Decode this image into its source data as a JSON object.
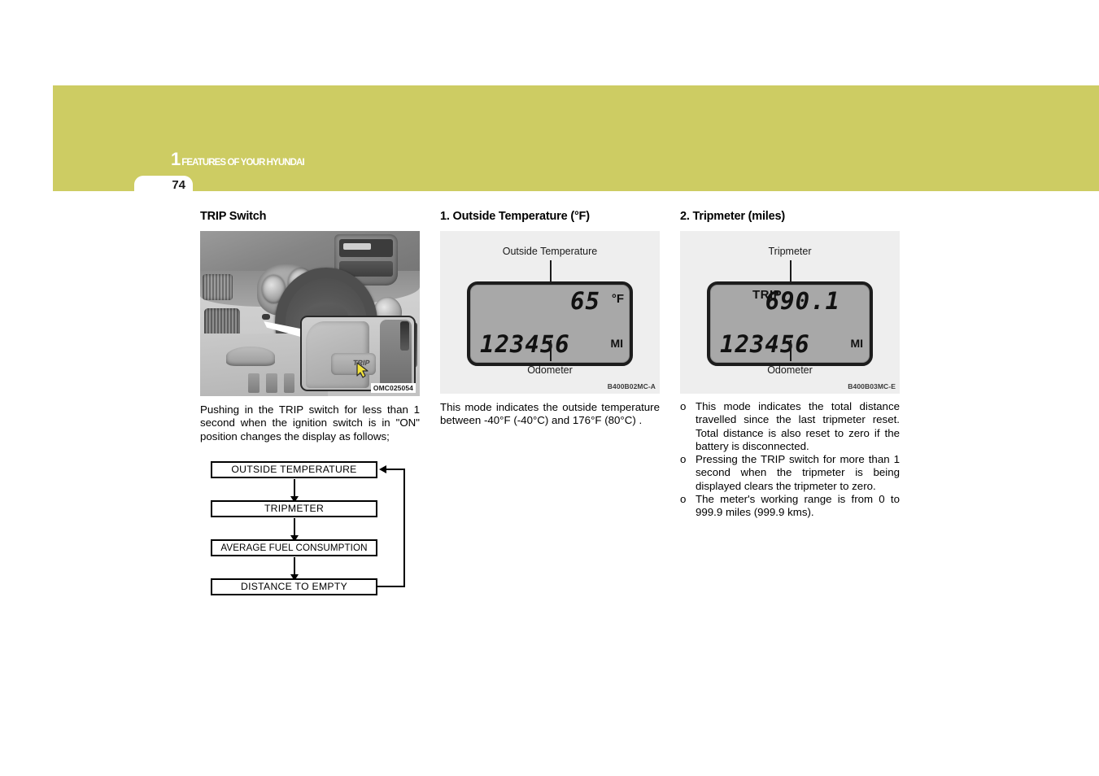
{
  "header": {
    "chapter_number": "1",
    "chapter_title": "FEATURES OF YOUR HYUNDAI",
    "page_number": "74",
    "banner_color": "#cdcc63"
  },
  "columns": {
    "left": {
      "heading": "TRIP Switch",
      "figure_code": "OMC025054",
      "paragraph": "Pushing in the TRIP switch for less than 1 second when the ignition switch is in \"ON\" position changes the display as follows;",
      "flowchart": {
        "steps": [
          "OUTSIDE TEMPERATURE",
          "TRIPMETER",
          "AVERAGE FUEL CONSUMPTION",
          "DISTANCE TO EMPTY"
        ]
      },
      "inset_button_label": "TRIP"
    },
    "middle": {
      "heading": "1. Outside Temperature (°F)",
      "figure_code": "B400B02MC-A",
      "caption_top": "Outside  Temperature",
      "caption_bottom": "Odometer",
      "lcd": {
        "temperature": "65",
        "temperature_unit": "°F",
        "odometer": "123456",
        "odometer_unit": "MI"
      },
      "paragraph": "This mode indicates the outside temperature between -40°F (-40°C) and 176°F (80°C) ."
    },
    "right": {
      "heading": "2. Tripmeter (miles)",
      "figure_code": "B400B03MC-E",
      "caption_top": "Tripmeter",
      "caption_bottom": "Odometer",
      "lcd": {
        "trip_label": "TRIP",
        "trip_value": "690.1",
        "odometer": "123456",
        "odometer_unit": "MI"
      },
      "bullets": [
        {
          "mark": "o",
          "text": "This mode indicates the total distance travelled since the last tripmeter reset. Total distance is also reset to zero if the battery is disconnected."
        },
        {
          "mark": "o",
          "text": "Pressing the TRIP switch for more than 1 second when the tripmeter is being displayed clears the tripmeter to zero."
        },
        {
          "mark": "o",
          "text": "The meter's  working range is from 0 to 999.9 miles (999.9 kms)."
        }
      ]
    }
  }
}
